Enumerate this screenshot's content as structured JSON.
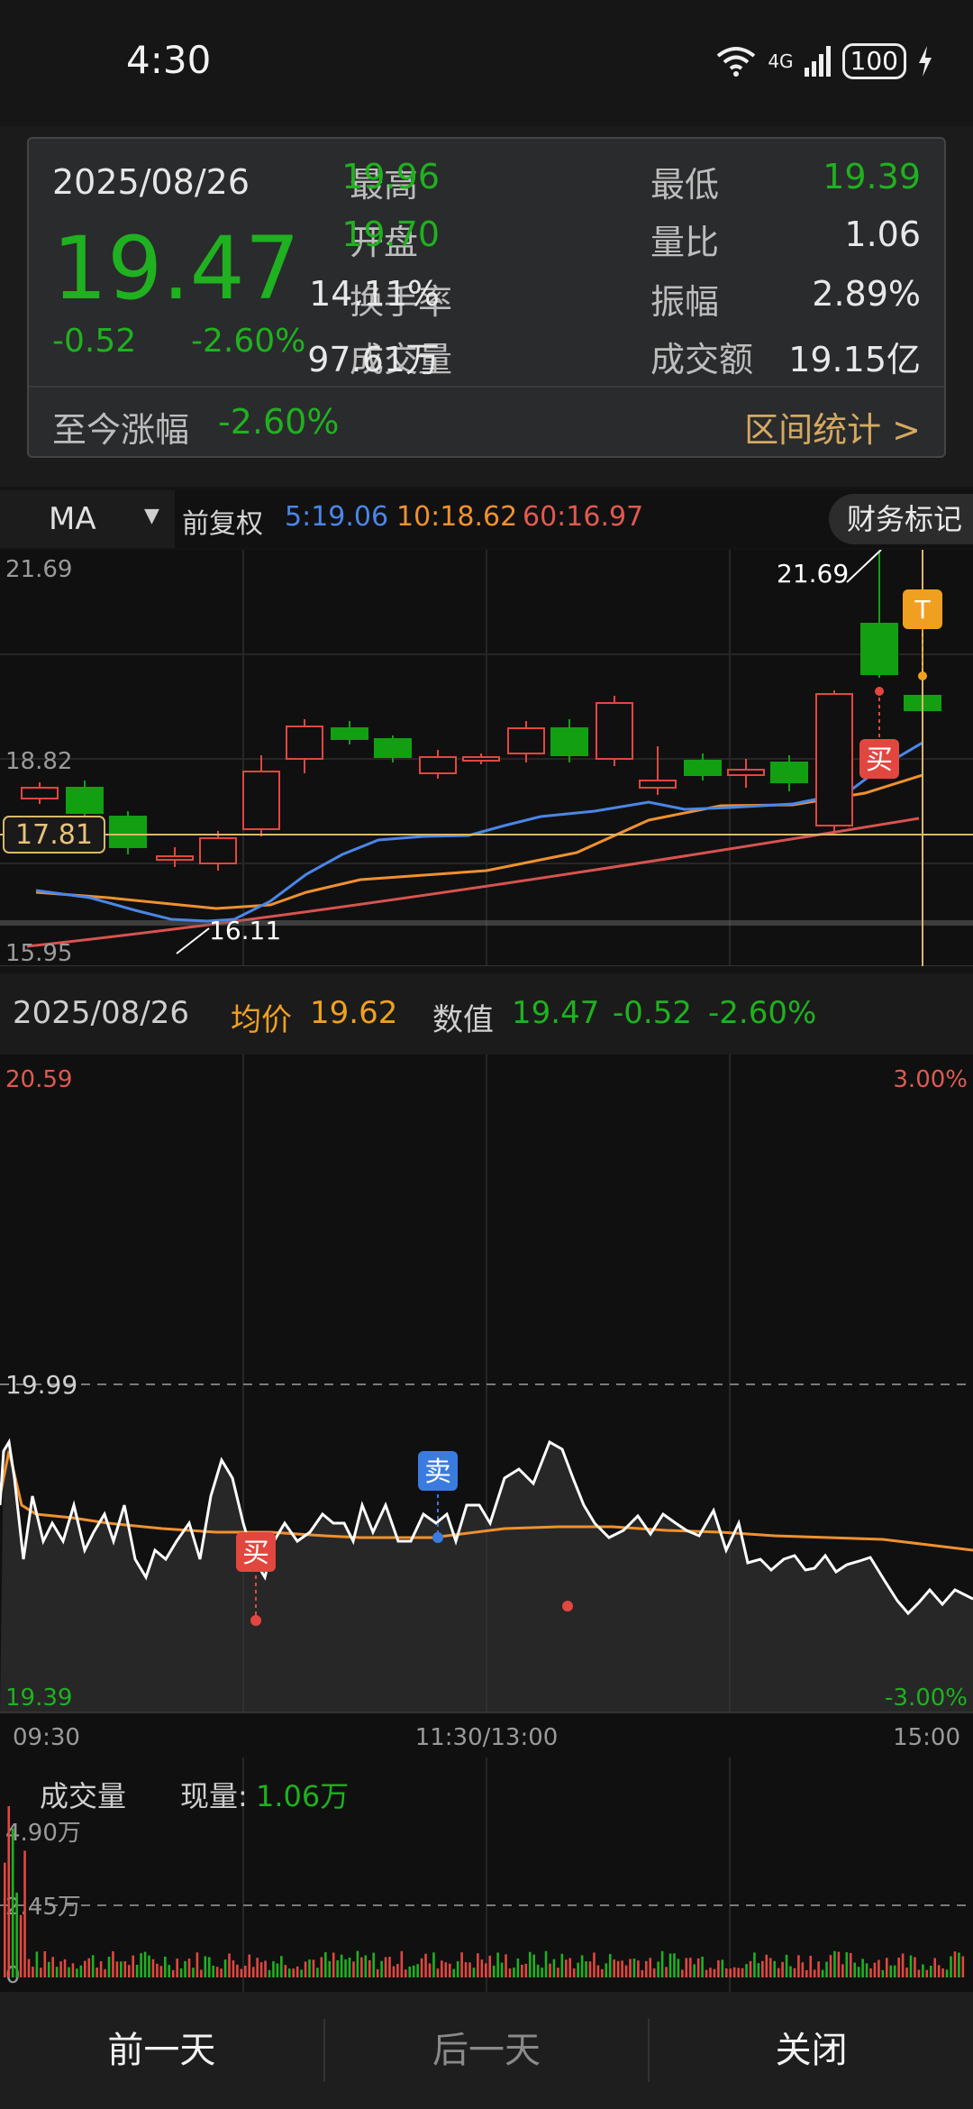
{
  "status": {
    "time": "4:30",
    "network": "4G",
    "battery": "100"
  },
  "info": {
    "date": "2025/08/26",
    "price": "19.47",
    "change": "-0.52",
    "change_pct": "-2.60%",
    "high_label": "最高",
    "high": "19.96",
    "low_label": "最低",
    "low": "19.39",
    "open_label": "开盘",
    "open": "19.70",
    "volratio_label": "量比",
    "volratio": "1.06",
    "turnover_label": "换手率",
    "turnover": "14.11%",
    "amplitude_label": "振幅",
    "amplitude": "2.89%",
    "volume_label": "成交量",
    "volume": "97.61万",
    "amount_label": "成交额",
    "amount": "19.15亿",
    "since_label": "至今涨幅",
    "since": "-2.60%",
    "interval_button": "区间统计 >"
  },
  "ma_bar": {
    "select": "MA",
    "adjust": "前复权",
    "ma5": "5:19.06",
    "ma10": "10:18.62",
    "ma60": "60:16.97",
    "fin_button": "财务标记"
  },
  "kline": {
    "y_max": "21.69",
    "y_mid": "18.82",
    "y_min": "15.95",
    "cursor_price": "17.81",
    "high_annot": "21.69",
    "low_annot": "16.11",
    "buy_marker": "买",
    "top_marker": "T",
    "colors": {
      "up": "#e2473f",
      "down": "#12a012",
      "ma5": "#4a86e8",
      "ma10": "#f0912e",
      "ma60": "#d9534f"
    }
  },
  "detail": {
    "date": "2025/08/26",
    "avg_label": "均价",
    "avg": "19.62",
    "value_label": "数值",
    "value": "19.47",
    "chg": "-0.52",
    "pct": "-2.60%"
  },
  "tick": {
    "y_top": "20.59",
    "y_mid": "19.99",
    "y_bottom": "19.39",
    "pct_top": "3.00%",
    "pct_bottom": "-3.00%",
    "time_start": "09:30",
    "time_mid": "11:30/13:00",
    "time_end": "15:00",
    "buy_marker": "买",
    "sell_marker": "卖"
  },
  "volume": {
    "title": "成交量",
    "current_label": "现量:",
    "current": "1.06万",
    "y_top": "4.90万",
    "y_mid": "2.45万",
    "y_bottom": "0"
  },
  "nav": {
    "prev": "前一天",
    "next": "后一天",
    "close": "关闭"
  }
}
